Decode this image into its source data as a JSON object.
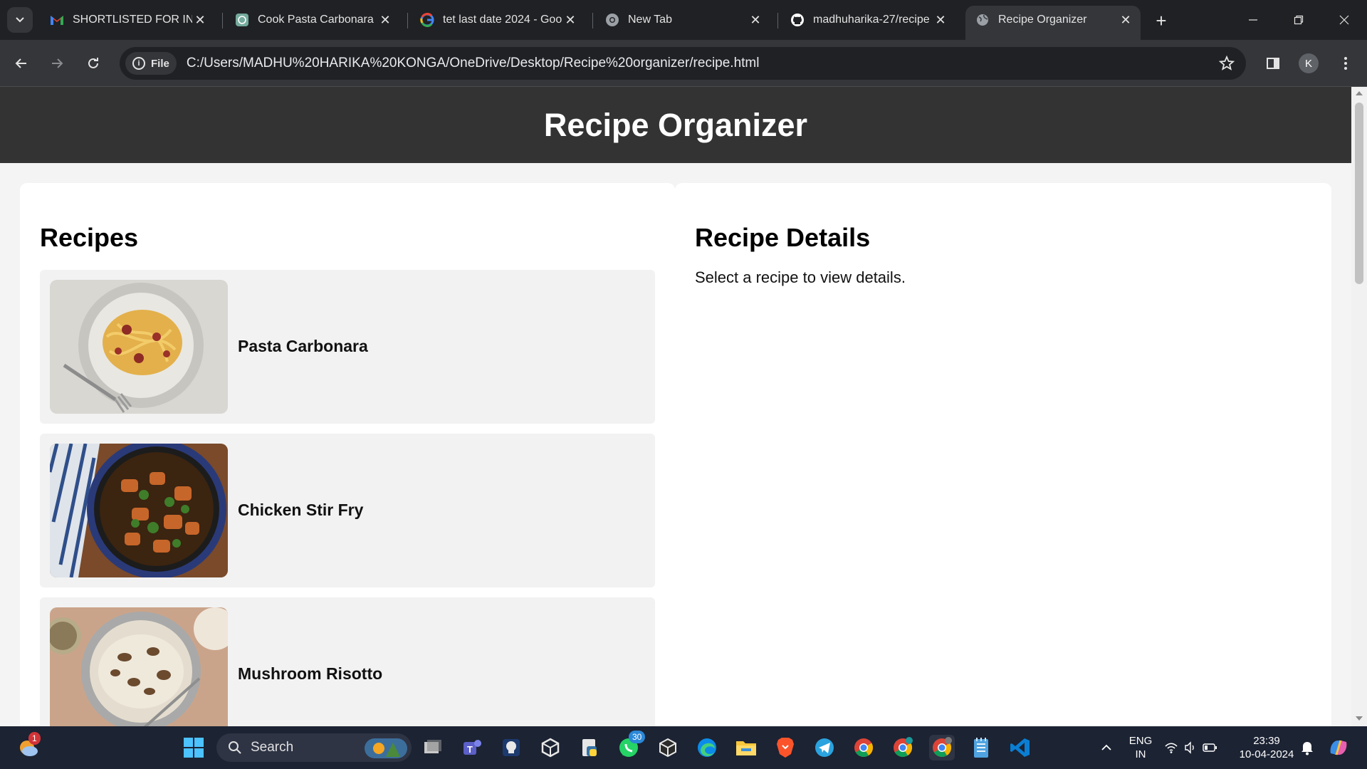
{
  "browser": {
    "tabs": [
      {
        "title": "SHORTLISTED FOR INTE",
        "favicon": "gmail-icon"
      },
      {
        "title": "Cook Pasta Carbonara",
        "favicon": "chatgpt-icon"
      },
      {
        "title": "tet last date 2024 - Goo",
        "favicon": "google-icon"
      },
      {
        "title": "New Tab",
        "favicon": "chrome-icon"
      },
      {
        "title": "madhuharika-27/recipe",
        "favicon": "github-icon"
      },
      {
        "title": "Recipe Organizer",
        "favicon": "globe-icon",
        "active": true
      }
    ],
    "address_chip": "File",
    "url": "C:/Users/MADHU%20HARIKA%20KONGA/OneDrive/Desktop/Recipe%20organizer/recipe.html",
    "profile_initial": "K"
  },
  "page": {
    "title": "Recipe Organizer",
    "recipes_heading": "Recipes",
    "recipes": [
      {
        "name": "Pasta Carbonara"
      },
      {
        "name": "Chicken Stir Fry"
      },
      {
        "name": "Mushroom Risotto"
      }
    ],
    "details_heading": "Recipe Details",
    "details_placeholder": "Select a recipe to view details."
  },
  "taskbar": {
    "search_label": "Search",
    "weather_badge": "1",
    "whatsapp_badge": "30",
    "language_line1": "ENG",
    "language_line2": "IN",
    "time": "23:39",
    "date": "10-04-2024"
  },
  "colors": {
    "header_bg": "#333333",
    "page_bg": "#f4f4f4",
    "card_bg": "#f2f2f2"
  }
}
